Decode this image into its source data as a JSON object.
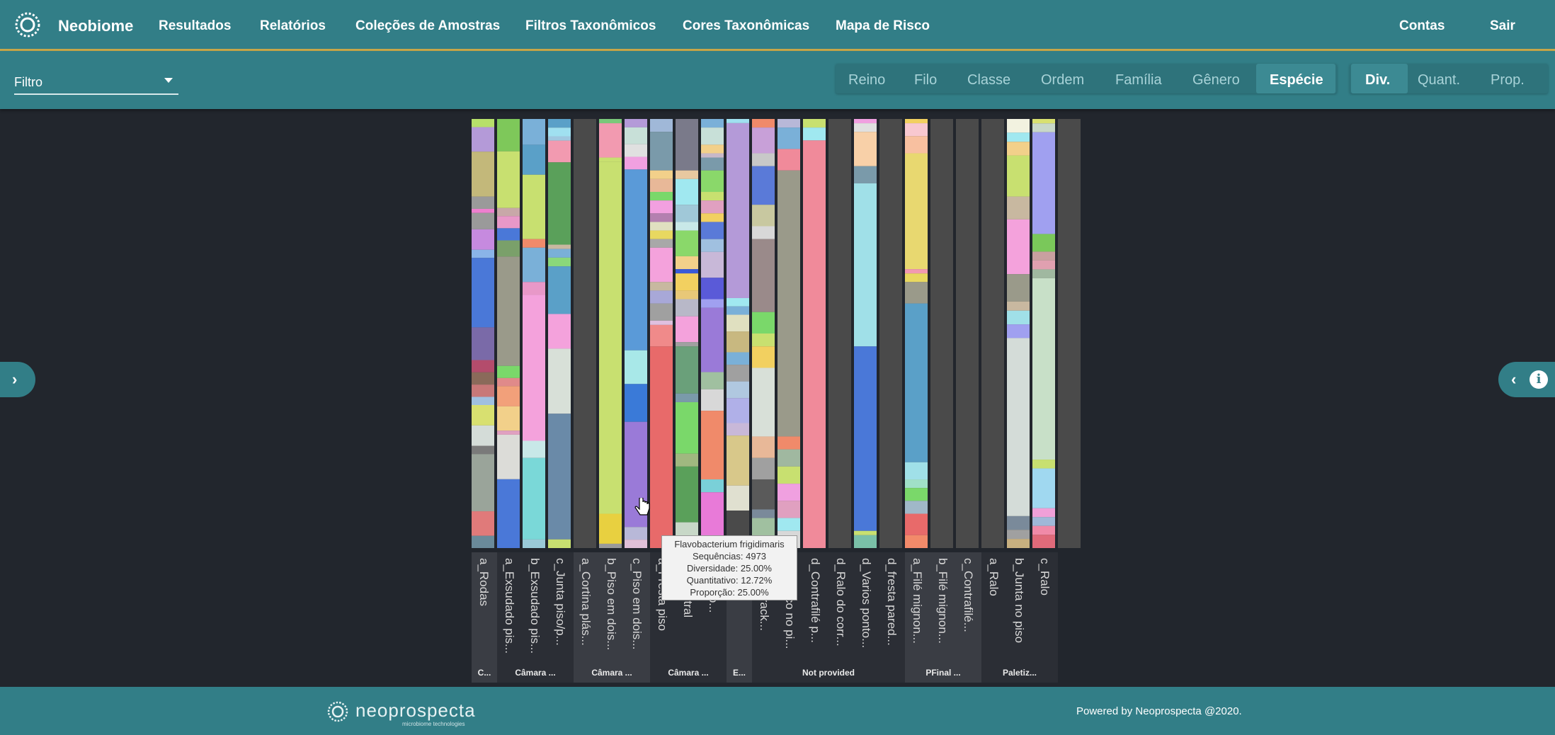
{
  "nav": {
    "brand": "Neobiome",
    "items": [
      "Resultados",
      "Relatórios",
      "Coleções de Amostras",
      "Filtros Taxonômicos",
      "Cores Taxonômicas",
      "Mapa de Risco"
    ],
    "right": [
      "Contas",
      "Sair"
    ]
  },
  "filter": {
    "label": "Filtro"
  },
  "levels": [
    "Reino",
    "Filo",
    "Classe",
    "Ordem",
    "Família",
    "Gênero",
    "Espécie"
  ],
  "level_active": "Espécie",
  "metrics": [
    "Div.",
    "Quant.",
    "Prop."
  ],
  "metric_active": "Div.",
  "tooltip": {
    "title": "Flavobacterium frigidimaris",
    "line1": "Sequências: 4973",
    "line2": "Diversidade: 25.00%",
    "line3": "Quantitativo: 12.72%",
    "line4": "Proporção: 25.00%"
  },
  "footer": {
    "brand": "neoprospecta",
    "sub": "microbiome technologies",
    "powered": "Powered by Neoprospecta @2020."
  },
  "chart_data": {
    "type": "bar",
    "stacked": true,
    "normalized": true,
    "categories": [
      "a_Rodas",
      "a_Exsudado pis...",
      "b_Exsudado pis...",
      "c_Junta piso/p...",
      "a_Cortina plás...",
      "b_Piso em dois...",
      "c_Piso em dois...",
      "a_Fresta piso",
      "b_...central",
      "c_...piso...",
      "a_...",
      "b_...de rack...",
      "d_Buraco no pi...",
      "d_Contrafilé p...",
      "d_Ralo do corr...",
      "d_Varios ponto...",
      "d_fresta pared...",
      "a_Filé mignon...",
      "b_Filé mignon...",
      "c_Contrafilé...",
      "a_Ralo",
      "b_Junta no piso",
      "c_Ralo"
    ],
    "groups": [
      {
        "label": "C...",
        "count": 1
      },
      {
        "label": "Câmara ...",
        "count": 3
      },
      {
        "label": "Câmara ...",
        "count": 3
      },
      {
        "label": "Câmara ...",
        "count": 3
      },
      {
        "label": "E...",
        "count": 1
      },
      {
        "label": "Not provided",
        "count": 6
      },
      {
        "label": "PFinal ...",
        "count": 3
      },
      {
        "label": "Paletiz...",
        "count": 3
      }
    ],
    "series_note": "stacked 100% species composition per sample (diversity view)",
    "stacks": [
      [
        [
          2,
          "#b7e06a"
        ],
        [
          6,
          "#b49ad8"
        ],
        [
          11,
          "#c3b87a"
        ],
        [
          3,
          "#9a9a9a"
        ],
        [
          1,
          "#ef7fcf"
        ],
        [
          4,
          "#9a9a9a"
        ],
        [
          5,
          "#c68adf"
        ],
        [
          2,
          "#8ab4e8"
        ],
        [
          17,
          "#4a78d8"
        ],
        [
          8,
          "#7a6aa8"
        ],
        [
          3,
          "#b44c6c"
        ],
        [
          3,
          "#8a6a5a"
        ],
        [
          3,
          "#c87878"
        ],
        [
          2,
          "#a0c0e0"
        ],
        [
          5,
          "#d8e070"
        ],
        [
          5,
          "#d4dcd8"
        ],
        [
          2,
          "#7a7a7a"
        ],
        [
          14,
          "#9aa49a"
        ],
        [
          6,
          "#e07a7a"
        ],
        [
          3,
          "#6a8a9a"
        ]
      ],
      [
        [
          8,
          "#7ec85a"
        ],
        [
          14,
          "#c8e070"
        ],
        [
          2,
          "#c8a8a8"
        ],
        [
          3,
          "#e898c8"
        ],
        [
          3,
          "#4a78d8"
        ],
        [
          4,
          "#7aa06a"
        ],
        [
          27,
          "#9a9a8a"
        ],
        [
          3,
          "#7ad86a"
        ],
        [
          2,
          "#e08a8a"
        ],
        [
          5,
          "#f2a07a"
        ],
        [
          6,
          "#f2d08a"
        ],
        [
          1,
          "#e0a0c0"
        ],
        [
          11,
          "#dcdcd8"
        ],
        [
          17,
          "#4a78d8"
        ]
      ],
      [
        [
          6,
          "#7ab0d8"
        ],
        [
          7,
          "#5aa0c8"
        ],
        [
          15,
          "#c8e070"
        ],
        [
          2,
          "#f08a6a"
        ],
        [
          8,
          "#7ab0d8"
        ],
        [
          3,
          "#e898c8"
        ],
        [
          34,
          "#f4a2dc"
        ],
        [
          4,
          "#c8e8e8"
        ],
        [
          19,
          "#7ad8d8"
        ],
        [
          2,
          "#9acad8"
        ]
      ],
      [
        [
          2,
          "#5aa0c8"
        ],
        [
          2,
          "#a0e0f0"
        ],
        [
          1,
          "#a0c8e0"
        ],
        [
          5,
          "#f29ab0"
        ],
        [
          19,
          "#5aa05a"
        ],
        [
          1,
          "#c8b8a0"
        ],
        [
          2,
          "#7ab0d8"
        ],
        [
          2,
          "#8ad87a"
        ],
        [
          11,
          "#5aa0c8"
        ],
        [
          8,
          "#f4a2dc"
        ],
        [
          15,
          "#d8e0d8"
        ],
        [
          29,
          "#6a8aa8"
        ],
        [
          2,
          "#c8e070"
        ]
      ],
      [
        [
          100,
          "#4a4a4a"
        ]
      ],
      [
        [
          1,
          "#7ac87a"
        ],
        [
          8,
          "#f29ab0"
        ],
        [
          1,
          "#c8e070"
        ],
        [
          82,
          "#c8e070"
        ],
        [
          7,
          "#e8d040"
        ],
        [
          1,
          "#9a9a9a"
        ]
      ],
      [
        [
          2,
          "#b49ad8"
        ],
        [
          4,
          "#c8e0d8"
        ],
        [
          3,
          "#e0e0e0"
        ],
        [
          3,
          "#f0a0e0"
        ],
        [
          43,
          "#5a9ad8"
        ],
        [
          8,
          "#a8e8e8"
        ],
        [
          9,
          "#3a7ad8"
        ],
        [
          25,
          "#9a7ad8"
        ],
        [
          3,
          "#b8b8d8"
        ],
        [
          2,
          "#e0c0d8"
        ]
      ],
      [
        [
          3,
          "#a0b8d8"
        ],
        [
          9,
          "#7a9aaa"
        ],
        [
          2,
          "#f2d08a"
        ],
        [
          3,
          "#e8b898"
        ],
        [
          2,
          "#7ad86a"
        ],
        [
          3,
          "#f2a0e0"
        ],
        [
          2,
          "#b480b0"
        ],
        [
          2,
          "#e0e0c0"
        ],
        [
          2,
          "#e8d860"
        ],
        [
          2,
          "#a8a8a8"
        ],
        [
          8,
          "#f4a2dc"
        ],
        [
          2,
          "#c8b8a0"
        ],
        [
          3,
          "#a8a8d8"
        ],
        [
          4,
          "#a0a0a0"
        ],
        [
          1,
          "#e0c0e0"
        ],
        [
          5,
          "#f08a8a"
        ],
        [
          47,
          "#e86a6a"
        ]
      ],
      [
        [
          12,
          "#7a7a8a"
        ],
        [
          2,
          "#e8c8a0"
        ],
        [
          6,
          "#a0e8f0"
        ],
        [
          4,
          "#a0c8d8"
        ],
        [
          2,
          "#c8e8e8"
        ],
        [
          6,
          "#8ad86a"
        ],
        [
          3,
          "#f2d08a"
        ],
        [
          1,
          "#3a5ad8"
        ],
        [
          4,
          "#f2d060"
        ],
        [
          2,
          "#e8c878"
        ],
        [
          4,
          "#b8b8c8"
        ],
        [
          6,
          "#f4a2dc"
        ],
        [
          1,
          "#a0a0a0"
        ],
        [
          11,
          "#6aa07a"
        ],
        [
          2,
          "#7a9aaa"
        ],
        [
          12,
          "#7ad86a"
        ],
        [
          3,
          "#a0b880"
        ],
        [
          13,
          "#5aa05a"
        ],
        [
          6,
          "#c8d8c8"
        ]
      ],
      [
        [
          2,
          "#7ab0d8"
        ],
        [
          4,
          "#c8e0d8"
        ],
        [
          2,
          "#f2d08a"
        ],
        [
          1,
          "#c8b8c8"
        ],
        [
          3,
          "#7a9aaa"
        ],
        [
          5,
          "#8ad86a"
        ],
        [
          2,
          "#c8e070"
        ],
        [
          3,
          "#e0a0c0"
        ],
        [
          2,
          "#f2d060"
        ],
        [
          4,
          "#5a7ad8"
        ],
        [
          3,
          "#a0c0e0"
        ],
        [
          6,
          "#c8b8d8"
        ],
        [
          5,
          "#5a5ad8"
        ],
        [
          2,
          "#a0a0f0"
        ],
        [
          15,
          "#9a7ad8"
        ],
        [
          4,
          "#a0c0a0"
        ],
        [
          5,
          "#d8d8d8"
        ],
        [
          16,
          "#f08a6a"
        ],
        [
          3,
          "#7ad0d8"
        ],
        [
          13,
          "#e87ad8"
        ]
      ],
      [
        [
          1,
          "#a0e0f0"
        ],
        [
          42,
          "#b49ad8"
        ],
        [
          2,
          "#a0e8f0"
        ],
        [
          2,
          "#7ab0d8"
        ],
        [
          4,
          "#e0e0c0"
        ],
        [
          5,
          "#c8b880"
        ],
        [
          3,
          "#7ab0d8"
        ],
        [
          4,
          "#a0a0a0"
        ],
        [
          4,
          "#b0c8e0"
        ],
        [
          6,
          "#b0b0e8"
        ],
        [
          3,
          "#c8b8d8"
        ],
        [
          12,
          "#d8c88a"
        ],
        [
          6,
          "#e0e0d0"
        ],
        [
          6,
          "#4a4a4a"
        ],
        [
          3,
          "#8aa0a0"
        ]
      ],
      [
        [
          2,
          "#f08a6a"
        ],
        [
          6,
          "#c8a0d8"
        ],
        [
          3,
          "#c8c8c8"
        ],
        [
          9,
          "#5a7ad8"
        ],
        [
          5,
          "#c8c8a0"
        ],
        [
          3,
          "#d8d8d8"
        ],
        [
          17,
          "#9a8a8a"
        ],
        [
          5,
          "#7ad86a"
        ],
        [
          3,
          "#c8e070"
        ],
        [
          5,
          "#f2d060"
        ],
        [
          16,
          "#d8e0d8"
        ],
        [
          5,
          "#e8b898"
        ],
        [
          5,
          "#a0a0a0"
        ],
        [
          7,
          "#5a5a5a"
        ],
        [
          2,
          "#7a8a9a"
        ],
        [
          7,
          "#a0c0a0"
        ]
      ],
      [
        [
          2,
          "#b8b8d8"
        ],
        [
          5,
          "#7ab0d8"
        ],
        [
          5,
          "#f08a9a"
        ],
        [
          62,
          "#9a9a8a"
        ],
        [
          3,
          "#f08a6a"
        ],
        [
          4,
          "#a0b8a0"
        ],
        [
          4,
          "#c8e070"
        ],
        [
          4,
          "#f0a0e0"
        ],
        [
          4,
          "#e0a0c0"
        ],
        [
          3,
          "#a0e8f0"
        ],
        [
          4,
          "#d8d8d8"
        ]
      ],
      [
        [
          2,
          "#c8e070"
        ],
        [
          3,
          "#a0e8f0"
        ],
        [
          95,
          "#f08a9a"
        ]
      ],
      [
        [
          100,
          "#4a4a4a"
        ]
      ],
      [
        [
          1,
          "#f0a0e0"
        ],
        [
          2,
          "#e0e0e0"
        ],
        [
          8,
          "#f8d0a8"
        ],
        [
          4,
          "#7a9aaa"
        ],
        [
          38,
          "#a0e0e8"
        ],
        [
          43,
          "#4a78d8"
        ],
        [
          1,
          "#c8e070"
        ],
        [
          3,
          "#7ac0a8"
        ]
      ],
      [
        [
          100,
          "#4a4a4a"
        ]
      ],
      [
        [
          1,
          "#f2d060"
        ],
        [
          3,
          "#f8c8d0"
        ],
        [
          4,
          "#f8c0a0"
        ],
        [
          27,
          "#e8d870"
        ],
        [
          1,
          "#f29ab0"
        ],
        [
          2,
          "#e8d860"
        ],
        [
          5,
          "#9a9a8a"
        ],
        [
          37,
          "#5aa0c8"
        ],
        [
          4,
          "#a0e0e8"
        ],
        [
          2,
          "#a0e0c8"
        ],
        [
          3,
          "#7ad86a"
        ],
        [
          3,
          "#a0b8c8"
        ],
        [
          5,
          "#e86a6a"
        ],
        [
          3,
          "#f28a6a"
        ]
      ],
      [
        [
          100,
          "#4a4a4a"
        ]
      ],
      [
        [
          100,
          "#4a4a4a"
        ]
      ],
      [
        [
          100,
          "#4a4a4a"
        ]
      ],
      [
        [
          3,
          "#f2f2e0"
        ],
        [
          2,
          "#a0e8f0"
        ],
        [
          3,
          "#f2d08a"
        ],
        [
          9,
          "#c8e070"
        ],
        [
          5,
          "#c8b8a0"
        ],
        [
          12,
          "#f4a2dc"
        ],
        [
          6,
          "#9a9a8a"
        ],
        [
          2,
          "#c8b8a0"
        ],
        [
          3,
          "#a0e0e8"
        ],
        [
          3,
          "#a0a0f0"
        ],
        [
          39,
          "#d4dcd8"
        ],
        [
          3,
          "#7a8a9a"
        ],
        [
          2,
          "#a0a0a0"
        ],
        [
          2,
          "#c8b080"
        ]
      ],
      [
        [
          1,
          "#d8e070"
        ],
        [
          2,
          "#c8d8c8"
        ],
        [
          23,
          "#a0a0f0"
        ],
        [
          4,
          "#7ac85a"
        ],
        [
          2,
          "#c8a0a0"
        ],
        [
          2,
          "#e0a0b0"
        ],
        [
          2,
          "#a0b8a0"
        ],
        [
          41,
          "#c8e0c8"
        ],
        [
          2,
          "#c8e070"
        ],
        [
          9,
          "#a0d8f0"
        ],
        [
          2,
          "#f0a0d8"
        ],
        [
          2,
          "#a0b8d8"
        ],
        [
          2,
          "#f08aa8"
        ],
        [
          3,
          "#e06a7a"
        ]
      ],
      [
        [
          100,
          "#4a4a4a"
        ]
      ]
    ]
  }
}
